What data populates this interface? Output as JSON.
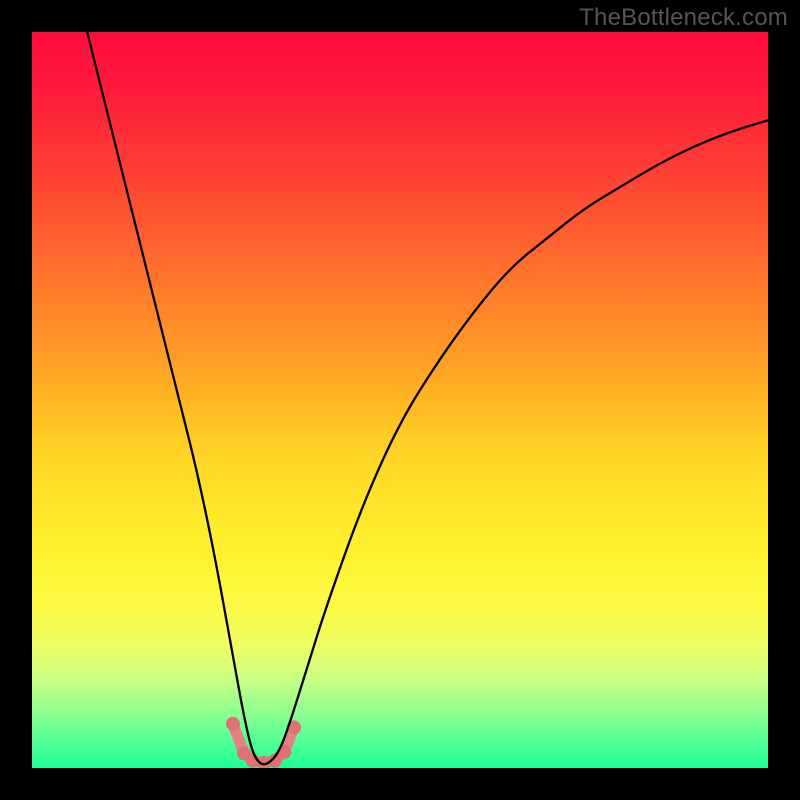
{
  "watermark": "TheBottleneck.com",
  "chart_data": {
    "type": "line",
    "title": "",
    "xlabel": "",
    "ylabel": "",
    "xlim": [
      0,
      100
    ],
    "ylim": [
      0,
      100
    ],
    "series": [
      {
        "name": "bottleneck-curve",
        "x": [
          7.5,
          10,
          12.5,
          15,
          17.5,
          20,
          22.5,
          25,
          27.5,
          29,
          30,
          31,
          32,
          33.5,
          35,
          37.5,
          40,
          45,
          50,
          55,
          60,
          65,
          70,
          75,
          80,
          85,
          90,
          95,
          100
        ],
        "y": [
          100,
          90,
          80,
          70,
          60,
          50,
          40,
          28,
          14,
          6,
          2,
          0.5,
          0.5,
          2,
          6,
          14,
          22,
          36,
          47,
          55,
          62,
          68,
          72,
          76,
          79,
          82,
          84.5,
          86.5,
          88
        ]
      }
    ],
    "markers": {
      "name": "highlight-points",
      "x": [
        27.3,
        28.8,
        30.0,
        31.5,
        33.0,
        34.3,
        35.6
      ],
      "y": [
        6.0,
        2.0,
        1.0,
        0.7,
        1.0,
        2.2,
        5.5
      ]
    },
    "colors": {
      "gradient_top": "#ff0b3e",
      "gradient_bottom": "#1eff95",
      "curve": "#000000",
      "marker_fill": "#dc7274",
      "glow": "#e28283",
      "frame": "#000000"
    }
  }
}
